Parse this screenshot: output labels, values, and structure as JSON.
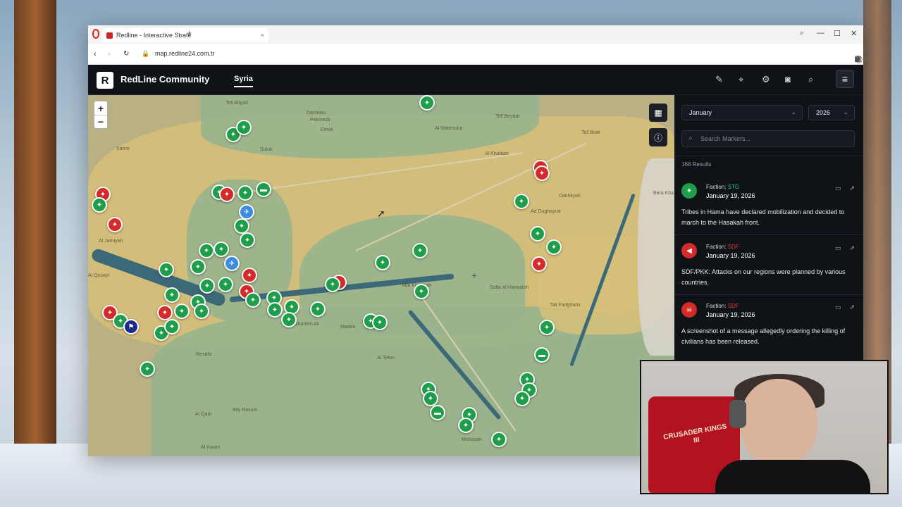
{
  "browser": {
    "tab_title": "Redline - Interactive Straté",
    "url": "map.redline24.com.tr",
    "new_tab_label": "+"
  },
  "app": {
    "logo_letter": "R",
    "brand": "RedLine Community",
    "nav_tab": "Syria",
    "menu_icon": "hamburger-icon"
  },
  "map": {
    "zoom_in": "+",
    "zoom_out": "−",
    "places": [
      "Tell Abyad",
      "Damlasu",
      "Pekmezli",
      "Emek",
      "Suluk",
      "Al Mabrouka",
      "Tell Beydar",
      "Tell Brak",
      "Al Khatitah",
      "Dakhilyah",
      "Ad Dughayrat",
      "Sarrin",
      "Al Jarniyah",
      "Abu Khashab",
      "Salla al Hawwash",
      "Tall Fadghami",
      "Ghanem Ali",
      "Madan",
      "Al Tebni",
      "Resafa",
      "Bily Rasum",
      "Al Qadr",
      "Al Kawm",
      "Muhasan",
      "Al Qusayr",
      "Bara Kha"
    ]
  },
  "panel": {
    "month": "January",
    "year": "2026",
    "search_placeholder": "Search Markers...",
    "results": "168 Results",
    "items": [
      {
        "faction_label": "Faction:",
        "faction": "STG",
        "faction_color": "#2ecc71",
        "date": "January 19, 2026",
        "text": "Tribes in Hama have declared mobilization and decided to march to the Hasakah front.",
        "icon_bg": "#1e9e4a",
        "icon": "rifle-icon"
      },
      {
        "faction_label": "Faction:",
        "faction": "SDF",
        "faction_color": "#e53935",
        "date": "January 19, 2026",
        "text": "SDF/PKK: Attacks on our regions were planned by various countries.",
        "icon_bg": "#d42a2a",
        "icon": "megaphone-icon"
      },
      {
        "faction_label": "Faction:",
        "faction": "SDF",
        "faction_color": "#e53935",
        "date": "January 19, 2026",
        "text": "A screenshot of a message allegedly ordering the killing of civilians has been released.",
        "icon_bg": "#d42a2a",
        "icon": "skull-icon"
      }
    ]
  },
  "webcam": {
    "chair_text": "CRUSADER KINGS III"
  }
}
